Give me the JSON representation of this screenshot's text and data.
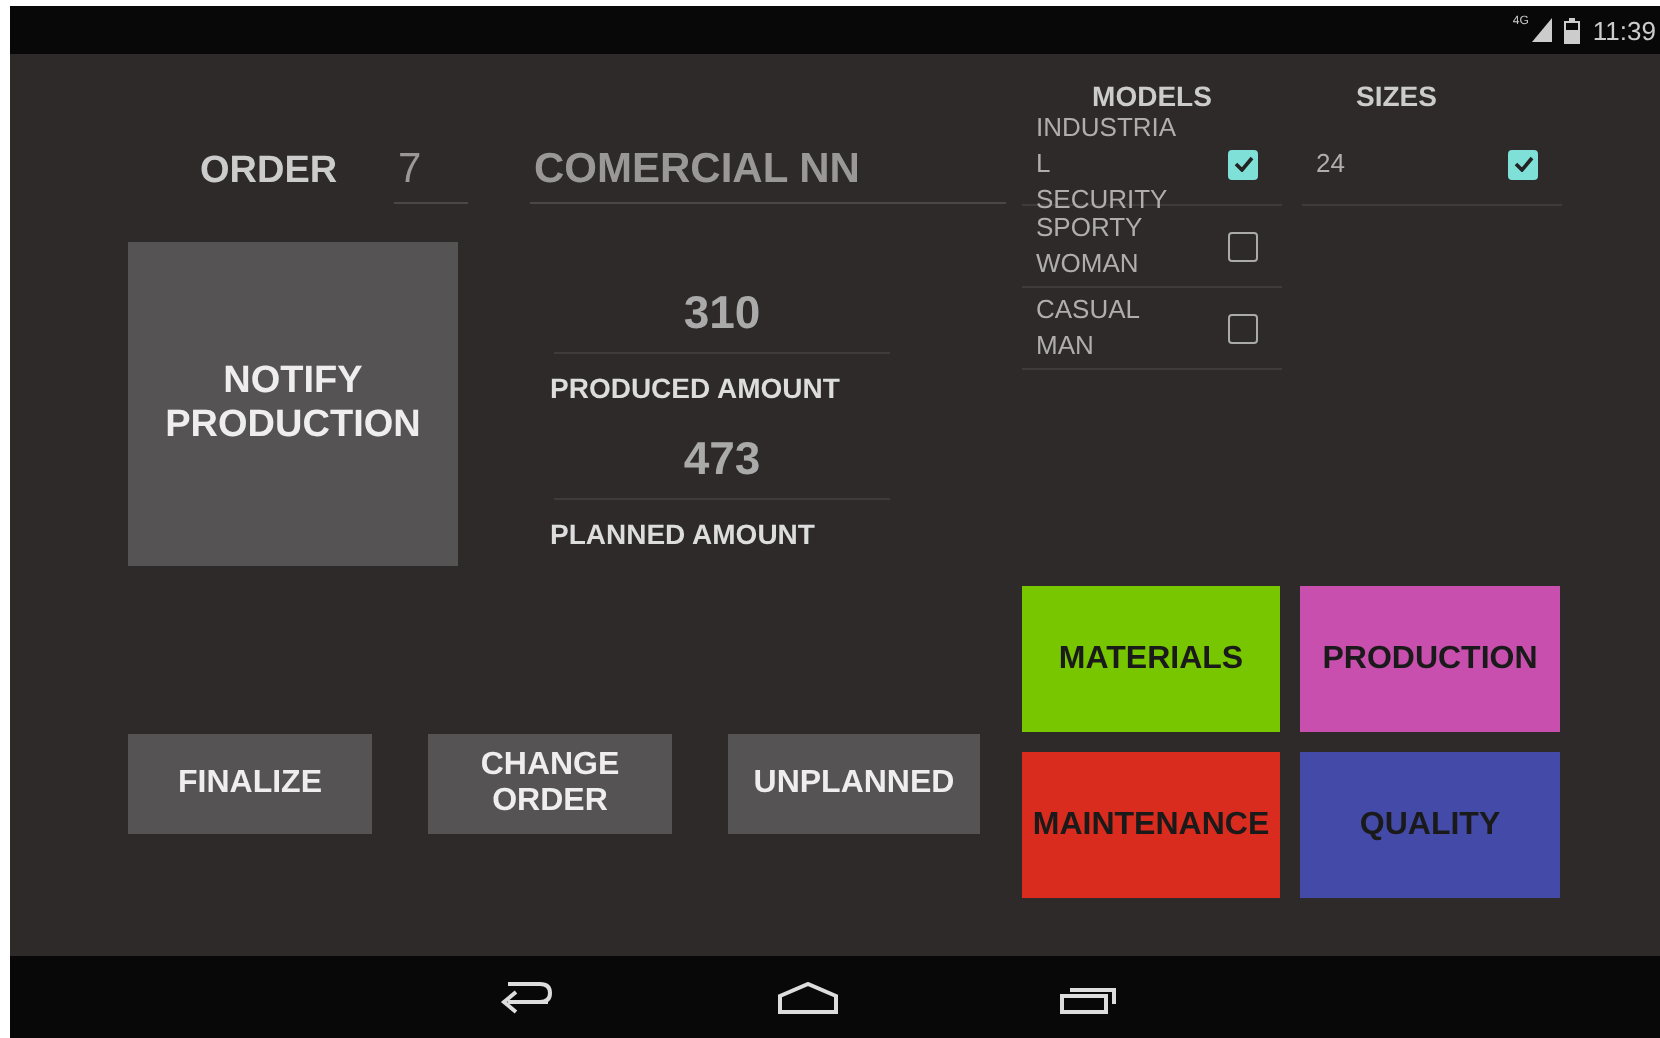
{
  "status_bar": {
    "network": "4G",
    "time": "11:39"
  },
  "order": {
    "label": "ORDER",
    "number": "7",
    "customer": "COMERCIAL NN"
  },
  "notify_button": {
    "label": "NOTIFY PRODUCTION"
  },
  "amounts": [
    {
      "value": "310",
      "label": "PRODUCED AMOUNT"
    },
    {
      "value": "473",
      "label": "PLANNED AMOUNT"
    }
  ],
  "actions": [
    {
      "label": "FINALIZE"
    },
    {
      "label": "CHANGE ORDER"
    },
    {
      "label": "UNPLANNED"
    }
  ],
  "models": {
    "title": "MODELS",
    "items": [
      {
        "label": "INDUSTRIAL SECURITY",
        "checked": true
      },
      {
        "label": "SPORTY WOMAN",
        "checked": false
      },
      {
        "label": "CASUAL MAN",
        "checked": false
      }
    ]
  },
  "sizes": {
    "title": "SIZES",
    "items": [
      {
        "label": "24",
        "checked": true
      }
    ]
  },
  "modules": [
    {
      "label": "MATERIALS",
      "color": "#77c600"
    },
    {
      "label": "PRODUCTION",
      "color": "#c84fae"
    },
    {
      "label": "MAINTENANCE",
      "color": "#d92b1e"
    },
    {
      "label": "QUALITY",
      "color": "#434aa8"
    }
  ]
}
